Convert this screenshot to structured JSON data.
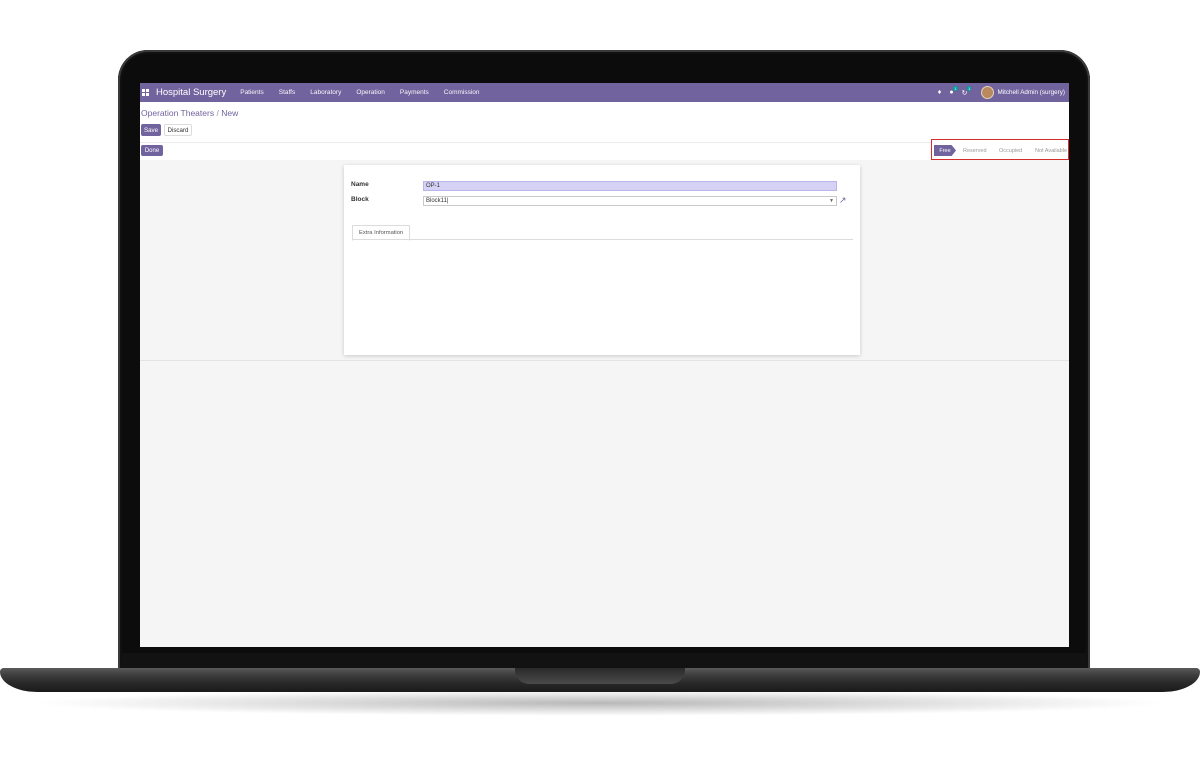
{
  "navbar": {
    "brand": "Hospital Surgery",
    "menu": [
      "Patients",
      "Staffs",
      "Laboratory",
      "Operation",
      "Payments",
      "Commission"
    ],
    "messages_badge": "1",
    "activity_badge": "1",
    "user": "Mitchell Admin (surgery)"
  },
  "breadcrumb": {
    "parent": "Operation Theaters",
    "separator": "/",
    "current": "New"
  },
  "actions": {
    "save": "Save",
    "discard": "Discard",
    "done": "Done"
  },
  "stages": [
    "Free",
    "Reserved",
    "Occupied",
    "Not Available"
  ],
  "form": {
    "name_label": "Name",
    "name_value": "OP-1",
    "block_label": "Block",
    "block_value": "Block11|"
  },
  "tabs": [
    "Extra Information"
  ],
  "colors": {
    "primary": "#71639e",
    "highlight": "#d62c2c",
    "active_input": "#d5d2f6"
  }
}
